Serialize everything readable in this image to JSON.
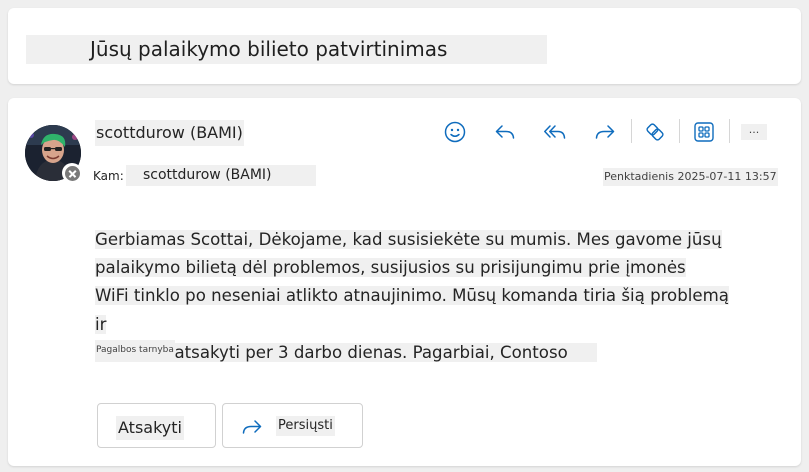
{
  "subject": "Jūsų palaikymo bilieto patvirtinimas",
  "message": {
    "sender": "scottdurow (BAMI)",
    "to_label": "Kam:",
    "to_value": "scottdurow (BAMI)",
    "date": "Penktadienis 2025-07-11 13:57",
    "body_lines": [
      "Gerbiamas Scottai, Dėkojame, kad susisiekėte su mumis. Mes gavome jūsų",
      "palaikymo bilietą dėl problemos, susijusios su prisijungimu prie įmonės",
      "WiFi tinklo po neseniai atlikto atnaujinimo. Mūsų komanda tiria šią problemą ir",
      "siekiame atsakyti per 3 darbo dienas. Pagarbiai, Contoso"
    ],
    "signature": "Pagalbos tarnyba"
  },
  "toolbar": {
    "icons": [
      "emoji-icon",
      "reply-icon",
      "reply-all-icon",
      "forward-icon",
      "loop-icon",
      "apps-icon"
    ],
    "more_label": "..."
  },
  "actions": {
    "reply_label": "Atsakyti",
    "forward_label": "Persiųsti"
  },
  "colors": {
    "accent": "#0f6cbd",
    "background": "#efefef",
    "highlight": "#f0f0f0"
  }
}
